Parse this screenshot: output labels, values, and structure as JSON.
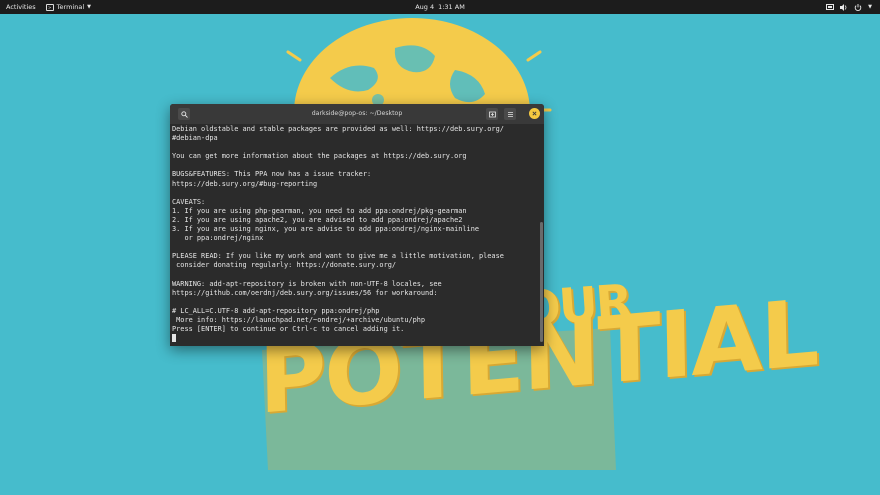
{
  "topbar": {
    "activities": "Activities",
    "app_name": "Terminal",
    "date": "Aug 4",
    "time": "1:31 AM",
    "icons": [
      "terminal-icon",
      "chevron-down-icon",
      "screen-icon",
      "volume-icon",
      "power-icon",
      "dropdown-icon"
    ]
  },
  "wallpaper": {
    "word_top": "OUR",
    "word_main": "POTENTIAL",
    "colors": {
      "background": "#46bccc",
      "accent": "#f4cb4b"
    }
  },
  "terminal": {
    "title": "darkside@pop-os: ~/Desktop",
    "header_icons": [
      "search-icon",
      "new-tab-icon",
      "menu-icon",
      "close-icon"
    ],
    "lines": [
      "Debian oldstable and stable packages are provided as well: https://deb.sury.org/",
      "#debian-dpa",
      "",
      "You can get more information about the packages at https://deb.sury.org",
      "",
      "BUGS&FEATURES: This PPA now has a issue tracker:",
      "https://deb.sury.org/#bug-reporting",
      "",
      "CAVEATS:",
      "1. If you are using php-gearman, you need to add ppa:ondrej/pkg-gearman",
      "2. If you are using apache2, you are advised to add ppa:ondrej/apache2",
      "3. If you are using nginx, you are advise to add ppa:ondrej/nginx-mainline",
      "   or ppa:ondrej/nginx",
      "",
      "PLEASE READ: If you like my work and want to give me a little motivation, please",
      " consider donating regularly: https://donate.sury.org/",
      "",
      "WARNING: add-apt-repository is broken with non-UTF-8 locales, see",
      "https://github.com/oerdnj/deb.sury.org/issues/56 for workaround:",
      "",
      "# LC_ALL=C.UTF-8 add-apt-repository ppa:ondrej/php",
      " More info: https://launchpad.net/~ondrej/+archive/ubuntu/php",
      "Press [ENTER] to continue or Ctrl-c to cancel adding it."
    ]
  }
}
